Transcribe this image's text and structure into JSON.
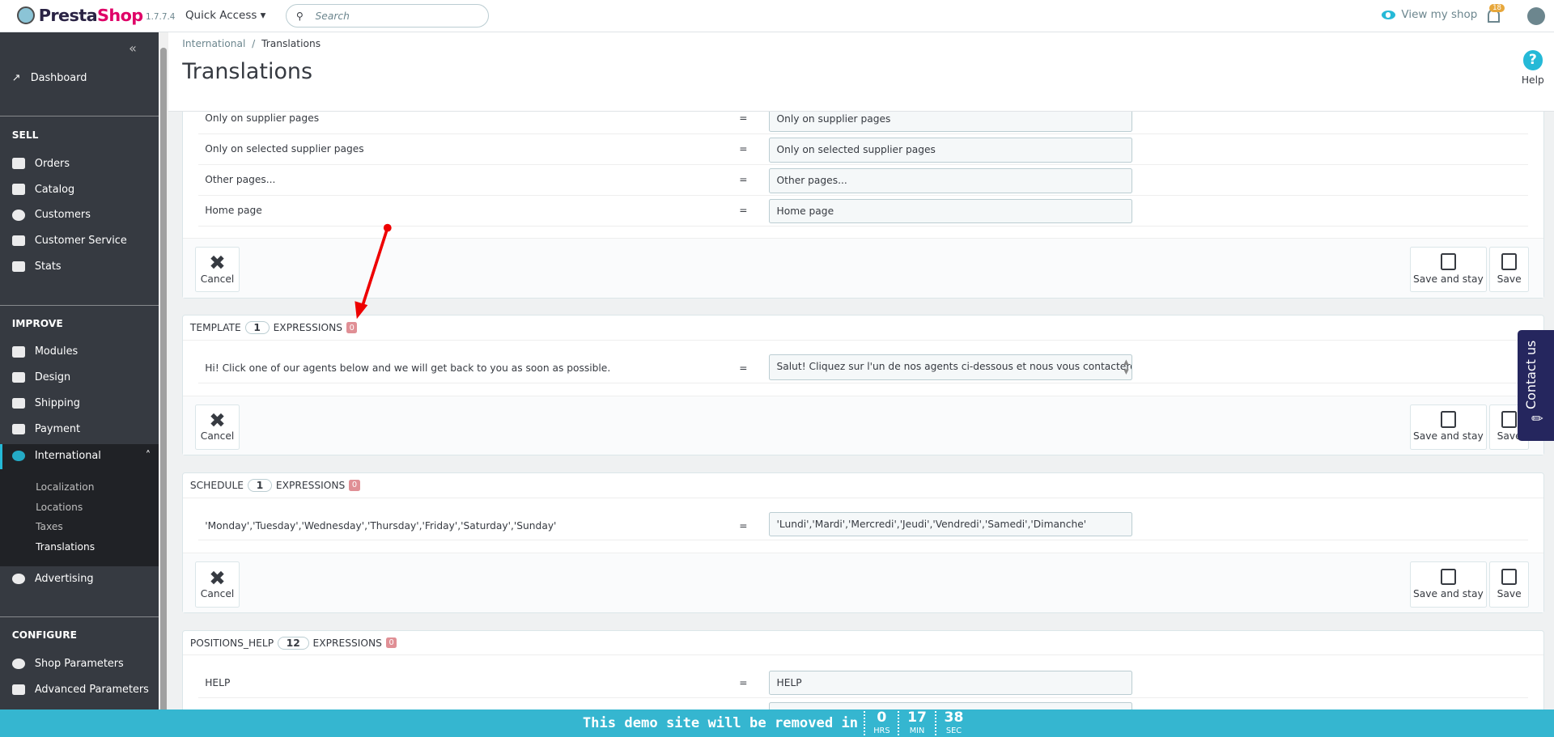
{
  "header": {
    "brand": "PrestaShop",
    "version": "1.7.7.4",
    "quick_access": "Quick Access",
    "search_placeholder": "Search",
    "view_shop": "View my shop",
    "notifications": "18"
  },
  "sidebar": {
    "dashboard": "Dashboard",
    "sell": "SELL",
    "orders": "Orders",
    "catalog": "Catalog",
    "customers": "Customers",
    "customer_service": "Customer Service",
    "stats": "Stats",
    "improve": "IMPROVE",
    "modules": "Modules",
    "design": "Design",
    "shipping": "Shipping",
    "payment": "Payment",
    "international": "International",
    "sub": [
      "Localization",
      "Locations",
      "Taxes",
      "Translations"
    ],
    "advertising": "Advertising",
    "configure": "CONFIGURE",
    "shop_parameters": "Shop Parameters",
    "advanced_parameters": "Advanced Parameters"
  },
  "page": {
    "breadcrumb_parent": "International",
    "breadcrumb_current": "Translations",
    "title": "Translations",
    "help": "Help"
  },
  "buttons": {
    "cancel": "Cancel",
    "save_and_stay": "Save and stay",
    "save": "Save"
  },
  "eq": "=",
  "panel1": {
    "rows": [
      {
        "src": "Only on supplier pages",
        "val": "Only on supplier pages"
      },
      {
        "src": "Only on selected supplier pages",
        "val": "Only on selected supplier pages"
      },
      {
        "src": "Other pages...",
        "val": "Other pages..."
      },
      {
        "src": "Home page",
        "val": "Home page"
      }
    ]
  },
  "panel2": {
    "name": "TEMPLATE",
    "count": "1",
    "expr": "EXPRESSIONS",
    "missing": "0",
    "rows": [
      {
        "src": "Hi! Click one of our agents below and we will get back to you as soon as possible.",
        "val": "Salut! Cliquez sur l'un de nos agents ci-dessous et nous vous contacterons"
      }
    ]
  },
  "panel3": {
    "name": "SCHEDULE",
    "count": "1",
    "expr": "EXPRESSIONS",
    "missing": "0",
    "rows": [
      {
        "src": "'Monday','Tuesday','Wednesday','Thursday','Friday','Saturday','Sunday'",
        "val": "'Lundi','Mardi','Mercredi','Jeudi','Vendredi','Samedi','Dimanche'"
      }
    ]
  },
  "panel4": {
    "name": "POSITIONS_HELP",
    "count": "12",
    "expr": "EXPRESSIONS",
    "missing": "0",
    "rows": [
      {
        "src": "HELP",
        "val": "HELP"
      }
    ]
  },
  "contact": "Contact us",
  "banner": {
    "message": "This demo site will be removed in",
    "hrs": "0",
    "hrs_label": "HRS",
    "min": "17",
    "min_label": "MIN",
    "sec": "38",
    "sec_label": "SEC"
  }
}
